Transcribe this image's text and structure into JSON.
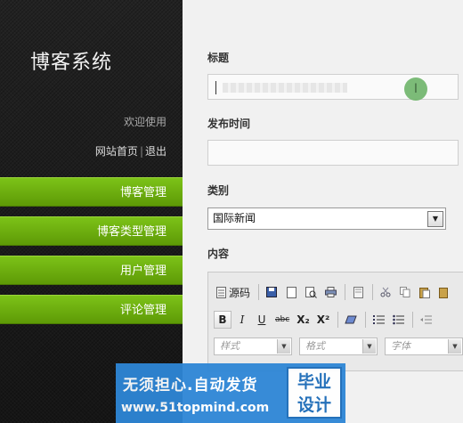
{
  "sidebar": {
    "brand": "博客系统",
    "welcome": "欢迎使用",
    "links": {
      "home": "网站首页",
      "separator": "|",
      "logout": "退出"
    },
    "menu": [
      "博客管理",
      "博客类型管理",
      "用户管理",
      "评论管理"
    ]
  },
  "form": {
    "title_label": "标题",
    "time_label": "发布时间",
    "category_label": "类别",
    "category_value": "国际新闻",
    "content_label": "内容"
  },
  "editor": {
    "source_label": "源码",
    "bold": "B",
    "italic": "I",
    "underline": "U",
    "strike": "abc",
    "subscript": "X₂",
    "superscript": "X²",
    "style_placeholder": "样式",
    "format_placeholder": "格式",
    "font_placeholder": "字体"
  },
  "watermark": {
    "line1": "无须担心.自动发货",
    "line2": "www.51topmind.com",
    "badge_line1": "毕业",
    "badge_line2": "设计"
  },
  "colors": {
    "menu_green": "#6aac0c",
    "sidebar_bg": "#1c1c1c",
    "watermark_blue": "#2e86d6"
  }
}
